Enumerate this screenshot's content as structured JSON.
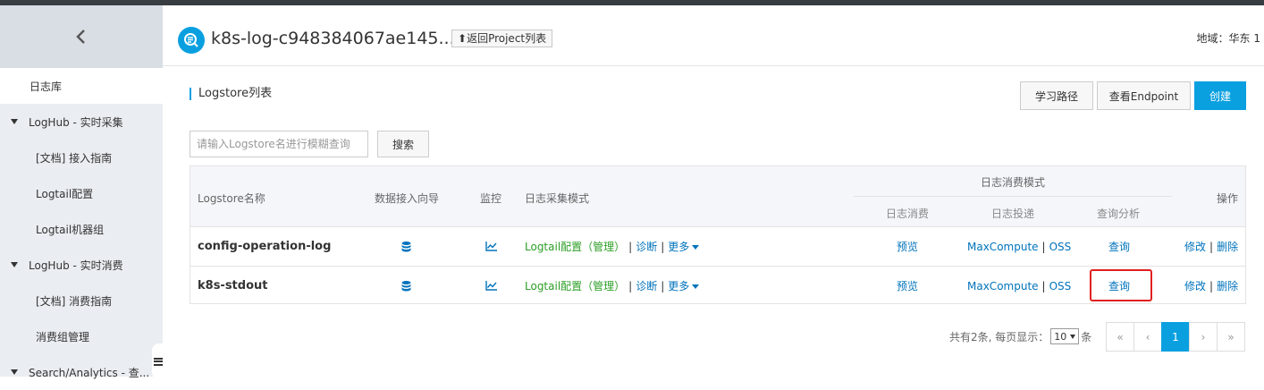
{
  "sidebar": {
    "items": [
      {
        "label": "日志库",
        "kind": "l0",
        "active": true
      },
      {
        "label": "LogHub - 实时采集",
        "kind": "group"
      },
      {
        "label": "[文档] 接入指南",
        "kind": "sub"
      },
      {
        "label": "Logtail配置",
        "kind": "sub"
      },
      {
        "label": "Logtail机器组",
        "kind": "sub"
      },
      {
        "label": "LogHub - 实时消费",
        "kind": "group"
      },
      {
        "label": "[文档] 消费指南",
        "kind": "sub"
      },
      {
        "label": "消费组管理",
        "kind": "sub"
      },
      {
        "label": "Search/Analytics - 查...",
        "kind": "group"
      }
    ]
  },
  "header": {
    "project_title": "k8s-log-c948384067ae145...",
    "back_label": "返回Project列表",
    "region": "地域：华东 1"
  },
  "section_title": "Logstore列表",
  "toolbar": {
    "learn_label": "学习路径",
    "endpoint_label": "查看Endpoint",
    "create_label": "创建"
  },
  "search": {
    "placeholder": "请输入Logstore名进行模糊查询",
    "button_label": "搜索"
  },
  "table": {
    "headers": {
      "name": "Logstore名称",
      "wizard": "数据接入向导",
      "monitor": "监控",
      "collect_mode": "日志采集模式",
      "consume_mode": "日志消费模式",
      "consume": "日志消费",
      "ship": "日志投递",
      "query": "查询分析",
      "actions": "操作"
    },
    "rows": [
      {
        "name": "config-operation-log",
        "logtail": "Logtail配置（管理）",
        "diagnose": "诊断",
        "more": "更多",
        "preview": "预览",
        "maxcompute": "MaxCompute",
        "oss": "OSS",
        "query": "查询",
        "edit": "修改",
        "delete": "删除"
      },
      {
        "name": "k8s-stdout",
        "logtail": "Logtail配置（管理）",
        "diagnose": "诊断",
        "more": "更多",
        "preview": "预览",
        "maxcompute": "MaxCompute",
        "oss": "OSS",
        "query": "查询",
        "edit": "修改",
        "delete": "删除"
      }
    ]
  },
  "pagination": {
    "total_text": "共有2条, 每页显示：",
    "page_size": "10",
    "unit": "条",
    "first": "«",
    "prev": "‹",
    "current": "1",
    "next": "›",
    "last": "»"
  },
  "colors": {
    "accent": "#0aa0e0",
    "link": "#0073bc",
    "logtail_green": "#2b9e25",
    "highlight_red": "#e02020"
  }
}
